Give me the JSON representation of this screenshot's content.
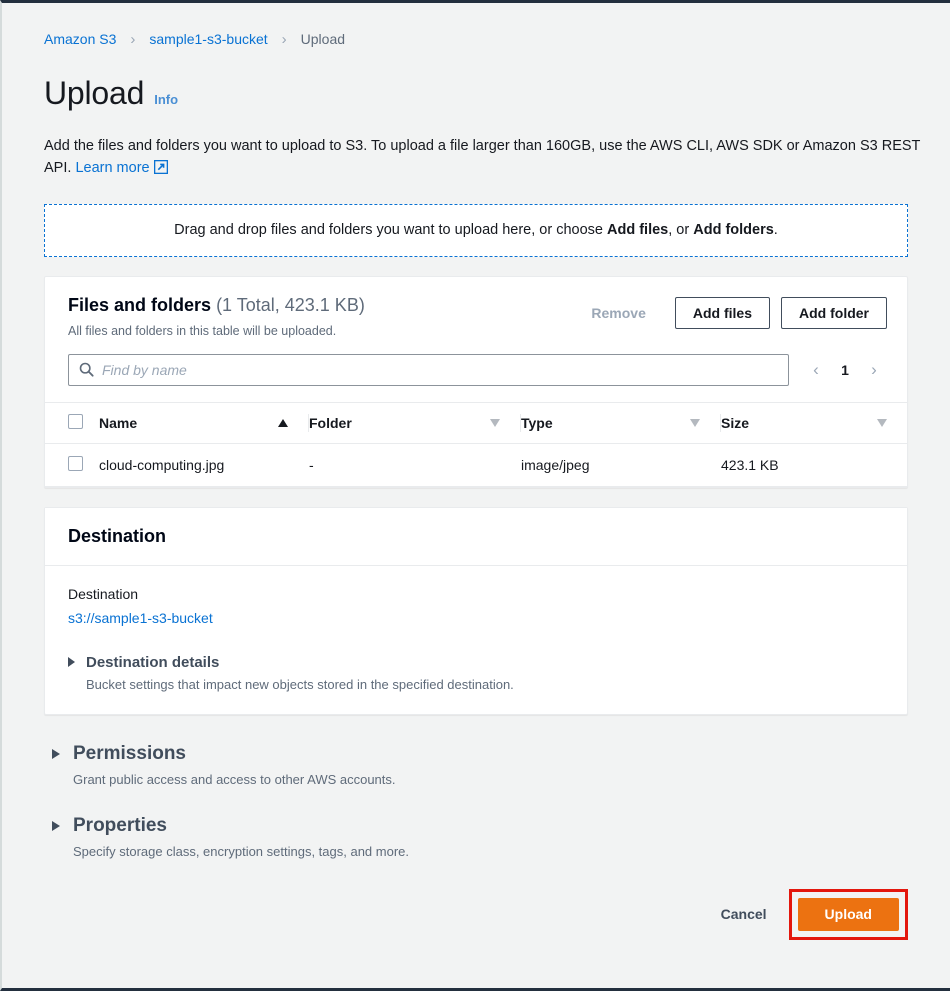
{
  "breadcrumb": {
    "items": [
      {
        "label": "Amazon S3",
        "type": "link"
      },
      {
        "label": "sample1-s3-bucket",
        "type": "link"
      },
      {
        "label": "Upload",
        "type": "current"
      }
    ],
    "separator": "›"
  },
  "header": {
    "title": "Upload",
    "info_label": "Info"
  },
  "description": {
    "text_before_link": "Add the files and folders you want to upload to S3. To upload a file larger than 160GB, use the AWS CLI, AWS SDK or Amazon S3 REST API.",
    "link_label": "Learn more",
    "link_icon": "external-link-icon"
  },
  "dropzone": {
    "prefix": "Drag and drop files and folders you want to upload here, or choose ",
    "bold_add_files": "Add files",
    "middle": ", or ",
    "bold_add_folders": "Add folders",
    "suffix": "."
  },
  "files_panel": {
    "title": "Files and folders",
    "count_label": "(1 Total, 423.1 KB)",
    "subtitle": "All files and folders in this table will be uploaded.",
    "buttons": {
      "remove": "Remove",
      "remove_disabled": true,
      "add_files": "Add files",
      "add_folder": "Add folder"
    },
    "search": {
      "placeholder": "Find by name",
      "value": "",
      "icon": "search-icon"
    },
    "pagination": {
      "prev_icon": "chevron-left-icon",
      "current_page": "1",
      "next_icon": "chevron-right-icon"
    },
    "table": {
      "columns": [
        {
          "label": "Name",
          "sort": "asc"
        },
        {
          "label": "Folder",
          "sort": "none"
        },
        {
          "label": "Type",
          "sort": "none"
        },
        {
          "label": "Size",
          "sort": "none"
        }
      ],
      "rows": [
        {
          "selected": false,
          "name": "cloud-computing.jpg",
          "folder": "-",
          "type": "image/jpeg",
          "size": "423.1 KB"
        }
      ]
    }
  },
  "destination": {
    "panel_title": "Destination",
    "field_label": "Destination",
    "field_value": "s3://sample1-s3-bucket",
    "details": {
      "title": "Destination details",
      "subtitle": "Bucket settings that impact new objects stored in the specified destination.",
      "expanded": false
    }
  },
  "sections": [
    {
      "title": "Permissions",
      "subtitle": "Grant public access and access to other AWS accounts.",
      "expanded": false
    },
    {
      "title": "Properties",
      "subtitle": "Specify storage class, encryption settings, tags, and more.",
      "expanded": false
    }
  ],
  "footer": {
    "cancel_label": "Cancel",
    "upload_label": "Upload",
    "upload_highlighted": true
  },
  "colors": {
    "accent_blue": "#0972d3",
    "primary_orange": "#ec7211",
    "highlight_red": "#e3170d",
    "page_background": "#f2f3f3",
    "panel_background": "#ffffff",
    "text_dark": "#16191f",
    "text_muted": "#5f6b7a"
  }
}
